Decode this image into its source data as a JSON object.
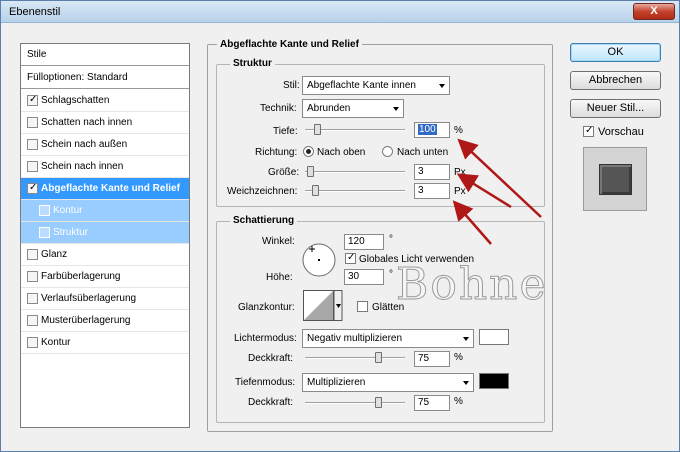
{
  "window": {
    "title": "Ebenenstil",
    "close_label": "X"
  },
  "styles_list": {
    "header": "Stile",
    "blend_options": "Fülloptionen: Standard",
    "items": [
      {
        "label": "Schlagschatten",
        "checked": true,
        "state": "normal"
      },
      {
        "label": "Schatten nach innen",
        "checked": false,
        "state": "normal"
      },
      {
        "label": "Schein nach außen",
        "checked": false,
        "state": "normal"
      },
      {
        "label": "Schein nach innen",
        "checked": false,
        "state": "normal"
      },
      {
        "label": "Abgeflachte Kante und Relief",
        "checked": true,
        "state": "selected"
      },
      {
        "label": "Kontur",
        "checked": false,
        "state": "sub"
      },
      {
        "label": "Struktur",
        "checked": false,
        "state": "sub"
      },
      {
        "label": "Glanz",
        "checked": false,
        "state": "normal"
      },
      {
        "label": "Farbüberlagerung",
        "checked": false,
        "state": "normal"
      },
      {
        "label": "Verlaufsüberlagerung",
        "checked": false,
        "state": "normal"
      },
      {
        "label": "Musterüberlagerung",
        "checked": false,
        "state": "normal"
      },
      {
        "label": "Kontur",
        "checked": false,
        "state": "normal"
      }
    ]
  },
  "bevel": {
    "title": "Abgeflachte Kante und Relief",
    "structure": {
      "title": "Struktur",
      "style_label": "Stil:",
      "style_value": "Abgeflachte Kante innen",
      "technique_label": "Technik:",
      "technique_value": "Abrunden",
      "depth_label": "Tiefe:",
      "depth_value": "100",
      "depth_unit": "%",
      "depth_level": 0.1,
      "direction_label": "Richtung:",
      "direction_up": "Nach oben",
      "direction_down": "Nach unten",
      "size_label": "Größe:",
      "size_value": "3",
      "size_unit": "Px",
      "size_level": 0.02,
      "soften_label": "Weichzeichnen:",
      "soften_value": "3",
      "soften_unit": "Px",
      "soften_level": 0.08
    },
    "shading": {
      "title": "Schattierung",
      "angle_label": "Winkel:",
      "angle_value": "120",
      "angle_unit": "°",
      "global_light_label": "Globales Licht verwenden",
      "global_light_checked": true,
      "altitude_label": "Höhe:",
      "altitude_value": "30",
      "altitude_unit": "°",
      "gloss_label": "Glanzkontur:",
      "antialias_label": "Glätten",
      "highlight_mode_label": "Lichtermodus:",
      "highlight_mode_value": "Negativ multiplizieren",
      "highlight_color": "#ffffff",
      "highlight_opacity_label": "Deckkraft:",
      "highlight_opacity_value": "75",
      "highlight_opacity_unit": "%",
      "highlight_opacity_level": 0.75,
      "shadow_mode_label": "Tiefenmodus:",
      "shadow_mode_value": "Multiplizieren",
      "shadow_color": "#000000",
      "shadow_opacity_label": "Deckkraft:",
      "shadow_opacity_value": "75",
      "shadow_opacity_unit": "%",
      "shadow_opacity_level": 0.75
    }
  },
  "buttons": {
    "ok": "OK",
    "cancel": "Abbrechen",
    "new_style": "Neuer Stil...",
    "preview_label": "Vorschau",
    "preview_checked": true
  },
  "watermark": "Bohne",
  "colors": {
    "selection": "#3399ff",
    "sub_selection": "#99ccff",
    "annotation_arrow": "#b01818"
  }
}
